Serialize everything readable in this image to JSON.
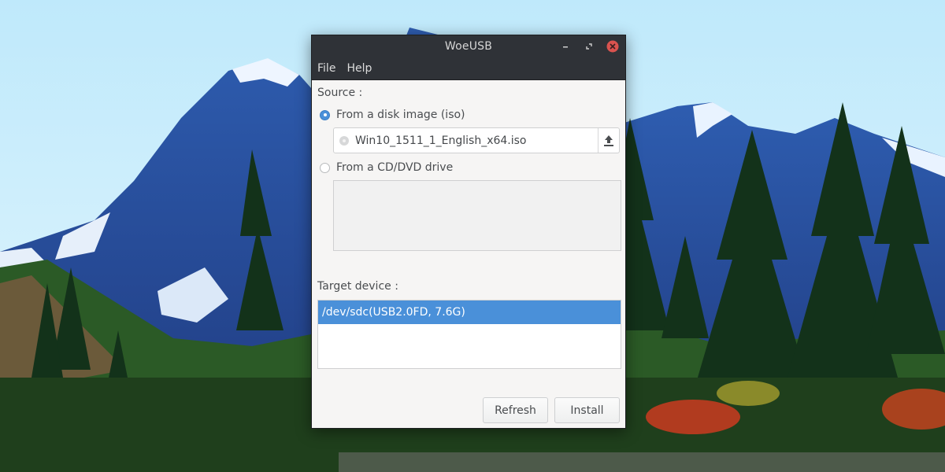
{
  "window": {
    "title": "WoeUSB",
    "controls": [
      "minimize-icon",
      "restore-icon",
      "close-icon"
    ],
    "close_color": "#d9534f"
  },
  "menu": {
    "file": "File",
    "help": "Help"
  },
  "source": {
    "label": "Source :",
    "option_iso": "From a disk image (iso)",
    "option_iso_selected": true,
    "iso_file": "Win10_1511_1_English_x64.iso",
    "upload_icon": "upload-icon",
    "option_cd": "From a CD/DVD drive",
    "option_cd_selected": false
  },
  "target": {
    "label": "Target device :",
    "devices": [
      "/dev/sdc(USB2.0FD,  7.6G)"
    ],
    "selected_index": 0,
    "selection_color": "#4a90d9"
  },
  "buttons": {
    "refresh": "Refresh",
    "install": "Install"
  }
}
